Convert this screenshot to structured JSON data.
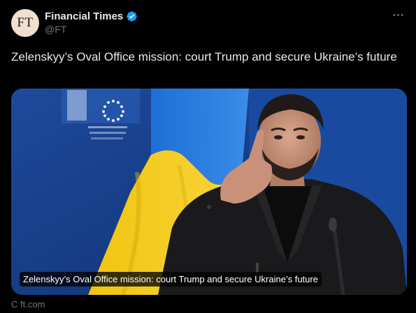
{
  "author": {
    "display_name": "Financial Times",
    "handle": "@FT",
    "avatar_text": "FT",
    "verified": true
  },
  "tweet": {
    "text": "Zelenskyy’s Oval Office mission: court Trump and secure Ukraine’s future"
  },
  "card": {
    "caption": "Zelenskyy’s Oval Office mission: court Trump and secure Ukraine’s future",
    "source": "C ft.com",
    "image_description_icon": "news-photo"
  },
  "colors": {
    "background": "#000000",
    "text_primary": "#e7e9ea",
    "text_secondary": "#71767b",
    "verified_blue": "#1d9bf0",
    "avatar_bg": "#f2dfce"
  },
  "icons": {
    "verified": "verified-badge-icon",
    "more": "more-horizontal-icon"
  }
}
